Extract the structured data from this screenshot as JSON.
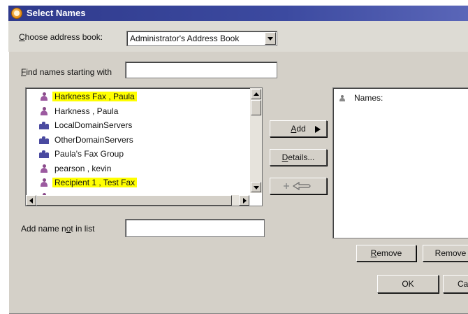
{
  "window": {
    "title": "Select Names"
  },
  "address_book": {
    "label_prefix": "C",
    "label_rest": "hoose address book:",
    "selected": "Administrator's Address Book"
  },
  "find": {
    "label_prefix": "F",
    "label_rest": "ind names starting with",
    "value": ""
  },
  "names_list": {
    "items": [
      {
        "label": "Harkness Fax , Paula",
        "icon": "person-icon",
        "highlighted": true
      },
      {
        "label": "Harkness , Paula",
        "icon": "person-icon",
        "highlighted": false
      },
      {
        "label": "LocalDomainServers",
        "icon": "group-icon",
        "highlighted": false
      },
      {
        "label": "OtherDomainServers",
        "icon": "group-icon",
        "highlighted": false
      },
      {
        "label": "Paula's Fax Group",
        "icon": "group-icon",
        "highlighted": false
      },
      {
        "label": "pearson , kevin",
        "icon": "person-icon",
        "highlighted": false
      },
      {
        "label": "Recipient 1 , Test Fax",
        "icon": "person-icon",
        "highlighted": true
      }
    ]
  },
  "buttons": {
    "add_prefix": "A",
    "add_rest": "dd",
    "details_prefix": "D",
    "details_rest": "etails...",
    "remove_prefix": "R",
    "remove_rest": "emove",
    "remove2_label": "Remove",
    "ok_label": "OK",
    "cancel_label": "Ca"
  },
  "add_not_in_list": {
    "label_a": "Add name n",
    "label_u": "o",
    "label_b": "t in list",
    "value": ""
  },
  "recipients": {
    "root_label": "Names:"
  },
  "colors": {
    "title_bar": "#2f3a8c",
    "highlight": "#ffff00",
    "dialog_bg": "#d4d0c8"
  }
}
